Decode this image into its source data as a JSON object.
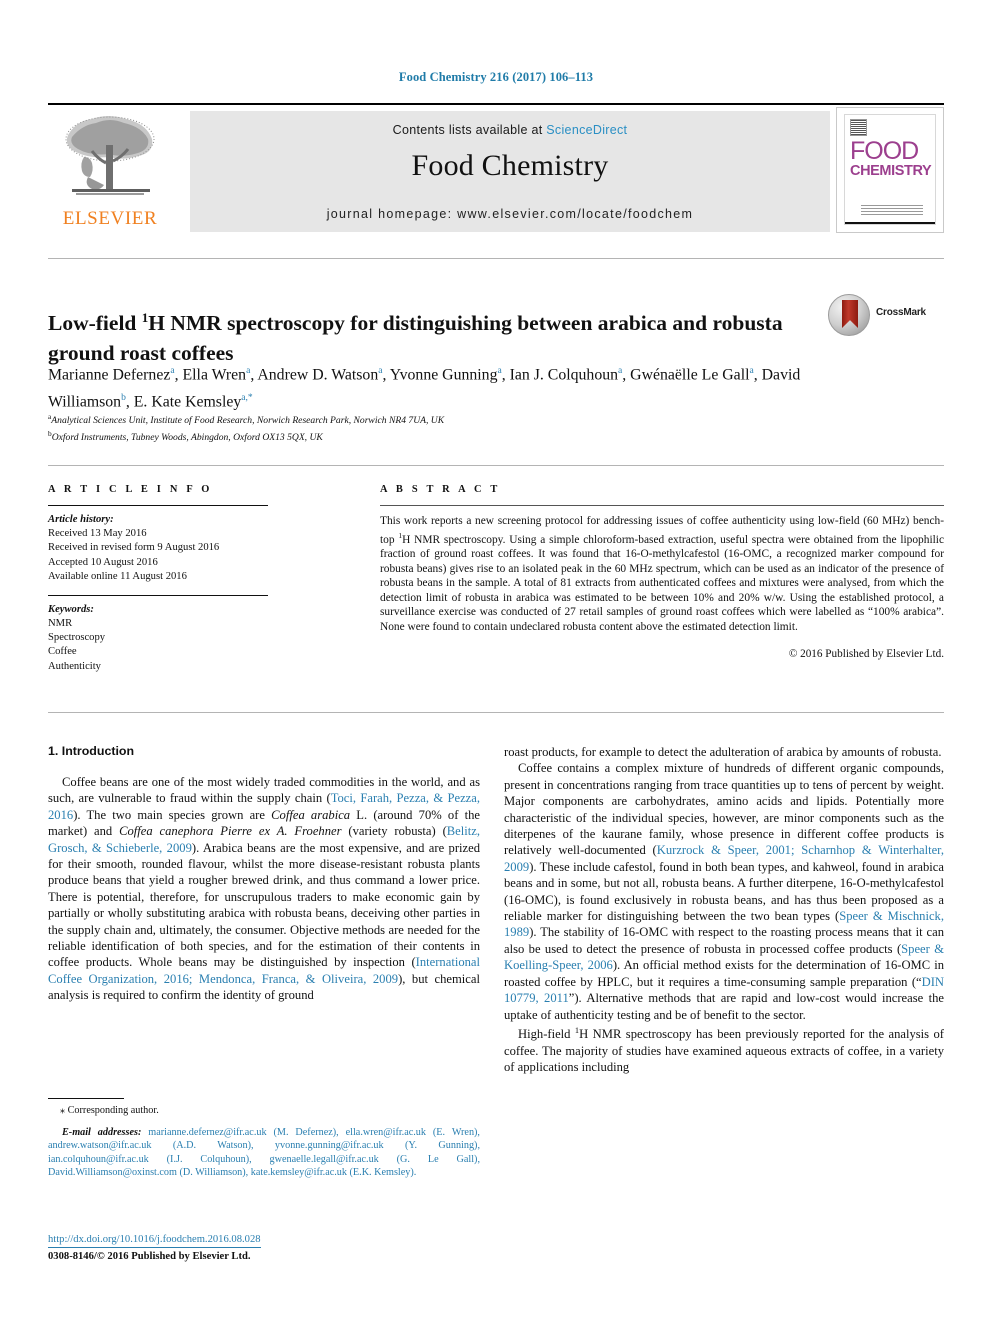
{
  "running_head": "Food Chemistry 216 (2017) 106–113",
  "masthead": {
    "publisher_name": "ELSEVIER",
    "contents_prefix": "Contents lists available at ",
    "contents_link": "ScienceDirect",
    "journal_title": "Food Chemistry",
    "homepage": "journal homepage: www.elsevier.com/locate/foodchem",
    "cover": {
      "line1": "FOOD",
      "line2": "CHEMISTRY"
    }
  },
  "article": {
    "title_line1": "Low-field ",
    "title_sup1": "1",
    "title_line1b": "H NMR spectroscopy for distinguishing between arabica and",
    "title_line2": "robusta ground roast coffees",
    "crossmark_label": "CrossMark",
    "authors": "Marianne Defernez a, Ella Wren a, Andrew D. Watson a, Yvonne Gunning a, Ian J. Colquhoun a, Gwénaëlle Le Gall a, David Williamson b, E. Kate Kemsley a,*",
    "affiliation_a": "Analytical Sciences Unit, Institute of Food Research, Norwich Research Park, Norwich NR4 7UA, UK",
    "affiliation_b": "Oxford Instruments, Tubney Woods, Abingdon, Oxford OX13 5QX, UK"
  },
  "article_info": {
    "heading": "A R T I C L E   I N F O",
    "history_label": "Article history:",
    "history": [
      "Received 13 May 2016",
      "Received in revised form 9 August 2016",
      "Accepted 10 August 2016",
      "Available online 11 August 2016"
    ],
    "keywords_label": "Keywords:",
    "keywords": [
      "NMR",
      "Spectroscopy",
      "Coffee",
      "Authenticity"
    ]
  },
  "abstract": {
    "heading": "A B S T R A C T",
    "text_part1": "This work reports a new screening protocol for addressing issues of coffee authenticity using low-field (60 MHz) bench-top ",
    "text_sup": "1",
    "text_part2": "H NMR spectroscopy. Using a simple chloroform-based extraction, useful spectra were obtained from the lipophilic fraction of ground roast coffees. It was found that 16-O-methylcafestol (16-OMC, a recognized marker compound for robusta beans) gives rise to an isolated peak in the 60 MHz spectrum, which can be used as an indicator of the presence of robusta beans in the sample. A total of 81 extracts from authenticated coffees and mixtures were analysed, from which the detection limit of robusta in arabica was estimated to be between 10% and 20% w/w. Using the established protocol, a surveillance exercise was conducted of 27 retail samples of ground roast coffees which were labelled as “100% arabica”. None were found to contain undeclared robusta content above the estimated detection limit.",
    "copyright": "© 2016 Published by Elsevier Ltd."
  },
  "introduction": {
    "heading": "1. Introduction",
    "left_p1_a": "Coffee beans are one of the most widely traded commodities in the world, and as such, are vulnerable to fraud within the supply chain (",
    "left_p1_ref1": "Toci, Farah, Pezza, & Pezza, 2016",
    "left_p1_b": "). The two main species grown are ",
    "left_p1_it1": "Coffea arabica",
    "left_p1_c": " L. (around 70% of the market) and ",
    "left_p1_it2": "Coffea canephora Pierre ex A. Froehner",
    "left_p1_d": " (variety robusta) (",
    "left_p1_ref2": "Belitz, Grosch, & Schieberle, 2009",
    "left_p1_e": "). Arabica beans are the most expensive, and are prized for their smooth, rounded flavour, whilst the more disease-resistant robusta plants produce beans that yield a rougher brewed drink, and thus command a lower price. There is potential, therefore, for unscrupulous traders to make economic gain by partially or wholly substituting arabica with robusta beans, deceiving other parties in the supply chain and, ultimately, the consumer. Objective methods are needed for the reliable identification of both species, and for the estimation of their contents in coffee products. Whole beans may be distinguished by inspection (",
    "left_p1_ref3": "International Coffee Organization, 2016; Mendonca, Franca, & Oliveira, 2009",
    "left_p1_f": "), but chemical analysis is required to confirm the identity of ground",
    "right_p0": "roast products, for example to detect the adulteration of arabica by amounts of robusta.",
    "right_p1_a": "Coffee contains a complex mixture of hundreds of different organic compounds, present in concentrations ranging from trace quantities up to tens of percent by weight. Major components are carbohydrates, amino acids and lipids. Potentially more characteristic of the individual species, however, are minor components such as the diterpenes of the kaurane family, whose presence in different coffee products is relatively well-documented (",
    "right_p1_ref1": "Kurzrock & Speer, 2001; Scharnhop & Winterhalter, 2009",
    "right_p1_b": "). These include cafestol, found in both bean types, and kahweol, found in arabica beans and in some, but not all, robusta beans. A further diterpene, 16-O-methylcafestol (16-OMC), is found exclusively in robusta beans, and has thus been proposed as a reliable marker for distinguishing between the two bean types (",
    "right_p1_ref2": "Speer & Mischnick, 1989",
    "right_p1_c": "). The stability of 16-OMC with respect to the roasting process means that it can also be used to detect the presence of robusta in processed coffee products (",
    "right_p1_ref3": "Speer & Koelling-Speer, 2006",
    "right_p1_d": "). An official method exists for the determination of 16-OMC in roasted coffee by HPLC, but it requires a time-consuming sample preparation (“",
    "right_p1_ref4": "DIN 10779, 2011",
    "right_p1_e": "”). Alternative methods that are rapid and low-cost would increase the uptake of authenticity testing and be of benefit to the sector.",
    "right_p2_a": "High-field ",
    "right_p2_sup": "1",
    "right_p2_b": "H NMR spectroscopy has been previously reported for the analysis of coffee. The majority of studies have examined aqueous extracts of coffee, in a variety of applications including"
  },
  "footnote": {
    "corresponding": "⁎ Corresponding author.",
    "emails_label": "E-mail addresses:",
    "emails_text": " marianne.defernez@ifr.ac.uk (M. Defernez), ella.wren@ifr.ac.uk (E. Wren), andrew.watson@ifr.ac.uk (A.D. Watson), yvonne.gunning@ifr.ac.uk (Y. Gunning), ian.colquhoun@ifr.ac.uk (I.J. Colquhoun), gwenaelle.legall@ifr.ac.uk (G. Le Gall), David.Williamson@oxinst.com (D. Williamson), kate.kemsley@ifr.ac.uk (E.K. Kemsley)."
  },
  "doi_block": {
    "doi": "http://dx.doi.org/10.1016/j.foodchem.2016.08.028",
    "issn": "0308-8146/© 2016 Published by Elsevier Ltd."
  },
  "colors": {
    "link_blue": "#2a7fb0",
    "sciencedirect_blue": "#2a8fc4",
    "elsevier_orange": "#f08020",
    "cover_magenta": "#9c3f8e",
    "running_head_blue": "#1f7ba8"
  }
}
